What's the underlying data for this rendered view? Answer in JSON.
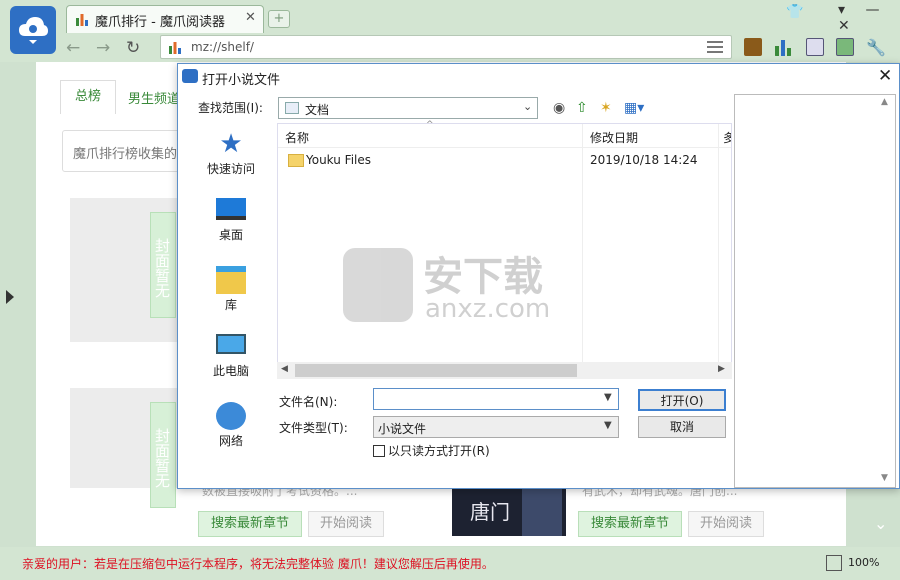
{
  "browser": {
    "tab_title": "魔爪排行 - 魔爪阅读器",
    "tab_close": "✕",
    "new_tab": "+",
    "address": "mz://shelf/",
    "window_controls": "▾ — ✕"
  },
  "page": {
    "tabs": [
      "总榜",
      "男生频道"
    ],
    "search_placeholder": "魔爪排行榜收集的",
    "cover_label": "封面暂无",
    "search_latest": "搜索最新章节",
    "start_reading": "开始阅读",
    "snippet_left": "数被直接吸附了考试资格。...",
    "snippet_right": "有武术，却有武魂。唐门创...",
    "book_title": "唐门"
  },
  "statusbar": {
    "warning": "亲爱的用户：若是在压缩包中运行本程序，将无法完整体验 魔爪！建议您解压后再使用。",
    "zoom": "100%"
  },
  "dialog": {
    "title": "打开小说文件",
    "look_in_label": "查找范围(I):",
    "look_in_value": "文档",
    "places": [
      "快速访问",
      "桌面",
      "库",
      "此电脑",
      "网络"
    ],
    "columns": [
      "名称",
      "修改日期",
      "多"
    ],
    "files": [
      {
        "name": "Youku Files",
        "date": "2019/10/18 14:24"
      }
    ],
    "filename_label": "文件名(N):",
    "filename_value": "",
    "filetype_label": "文件类型(T):",
    "filetype_value": "小说文件",
    "open_button": "打开(O)",
    "cancel_button": "取消",
    "readonly_label": "以只读方式打开(R)"
  },
  "watermark": {
    "text": "安下载",
    "sub": "anxz.com"
  },
  "colors": {
    "accent": "#2e6fc4",
    "green": "#3a8a3a",
    "warning": "#dd1122"
  }
}
